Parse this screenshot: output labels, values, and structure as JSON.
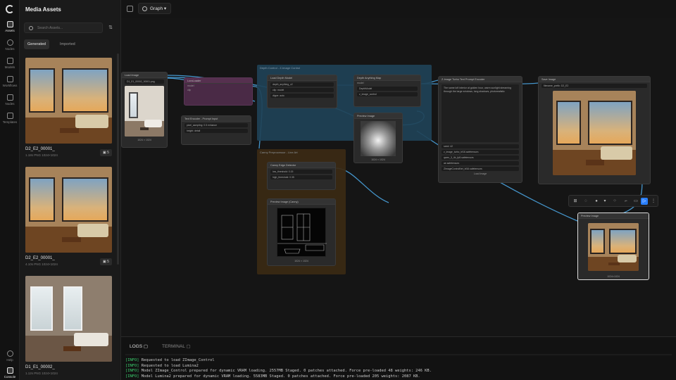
{
  "rail": {
    "items": [
      {
        "label": "Assets",
        "icon": "image-icon"
      },
      {
        "label": "Nodes",
        "icon": "circle-icon"
      },
      {
        "label": "Models",
        "icon": "cube-icon"
      },
      {
        "label": "Workflows",
        "icon": "flow-icon"
      },
      {
        "label": "Nodes",
        "icon": "list-icon"
      },
      {
        "label": "Templates",
        "icon": "template-icon"
      }
    ],
    "help_label": "Help",
    "console_label": "Console"
  },
  "assets": {
    "title": "Media Assets",
    "search_placeholder": "Search Assets...",
    "tabs": [
      "Generated",
      "Imported"
    ],
    "items": [
      {
        "name": "D2_E2_00001_",
        "meta": "1.18s PNG 1024×1024",
        "badge": "5"
      },
      {
        "name": "D2_E2_00001_",
        "meta": "4.10s PNG 1024×1024",
        "badge": "5"
      },
      {
        "name": "D1_E1_00002_",
        "meta": "1.12s PNG 1024×1024",
        "badge": ""
      }
    ]
  },
  "topbar": {
    "graph_tab": "Graph"
  },
  "canvas": {
    "groups": [
      {
        "title": "Depth Control - Z-Image Control"
      },
      {
        "title": "Canny Preprocessor - Line Art"
      }
    ],
    "nodes": {
      "load_image": {
        "title": "Load Image",
        "file": "D1_E1_00002_00001.png",
        "caption": "1024 × 1024"
      },
      "lora": {
        "title": "LoraLoader",
        "rows": [
          "model",
          "clip"
        ]
      },
      "text_encode": {
        "title": "Text Encoder - Prompt Input",
        "fields": [
          "pixel_sampling: 0.5 enhance",
          "height: detail"
        ]
      },
      "load_depth": {
        "title": "Load Depth Model",
        "fields": [
          "depth_anything_v2",
          "clip: model",
          "dtype: auto"
        ]
      },
      "depth_apply": {
        "title": "Depth Anything Map",
        "fields": [
          "model",
          "DepthModel",
          "ControlNet",
          "z_image_control"
        ]
      },
      "preview_depth": {
        "title": "Preview Image",
        "caption": "1024 × 1024"
      },
      "canny": {
        "title": "Canny Edge Detector",
        "fields": [
          "low_threshold: 0.15",
          "high_threshold: 0.35"
        ]
      },
      "preview_canny": {
        "title": "Preview Image (Canny)",
        "caption": "1024 × 1024"
      },
      "prompt": {
        "title": "Z-Image Turbo Text Prompt Encoder",
        "text": "The same loft interior at golden hour, warm sunlight streaming through the large windows, long shadows, photorealistic",
        "fields": [
          "seed: 42",
          "z_image_turbo_bf16.safetensors",
          "qwen_3_4b_fp8.safetensors",
          "ae.safetensors",
          "ZImageControlNet_bf16.safetensors"
        ],
        "caption": "Load Image"
      },
      "save_image": {
        "title": "Save Image",
        "prefix": "filename_prefix: D2_E2"
      },
      "preview_final": {
        "title": "Preview Image",
        "caption": "1024×1024"
      }
    }
  },
  "bottom": {
    "tabs": [
      "LOGS",
      "TERMINAL"
    ],
    "logs": [
      {
        "level": "[INFO]",
        "text": "Requested to load ZImage_Control"
      },
      {
        "level": "[INFO]",
        "text": "Requested to load Lumina2"
      },
      {
        "level": "[INFO]",
        "text": "Model ZImage_Control prepared for dynamic VRAM loading. 2557MB Staged. 0 patches attached. Force pre-loaded 48 weights: 246 KB."
      },
      {
        "level": "[INFO]",
        "text": "Model Lumina2 prepared for dynamic VRAM loading. 5583MB Staged. 0 patches attached. Force pre-loaded 205 weights: 2087 KB."
      }
    ]
  },
  "colors": {
    "accent": "#2a7fff",
    "link": "#4aa3df",
    "log_level": "#3bd16f",
    "depth_group": "#1f4257",
    "canny_group": "#3b2a14"
  }
}
